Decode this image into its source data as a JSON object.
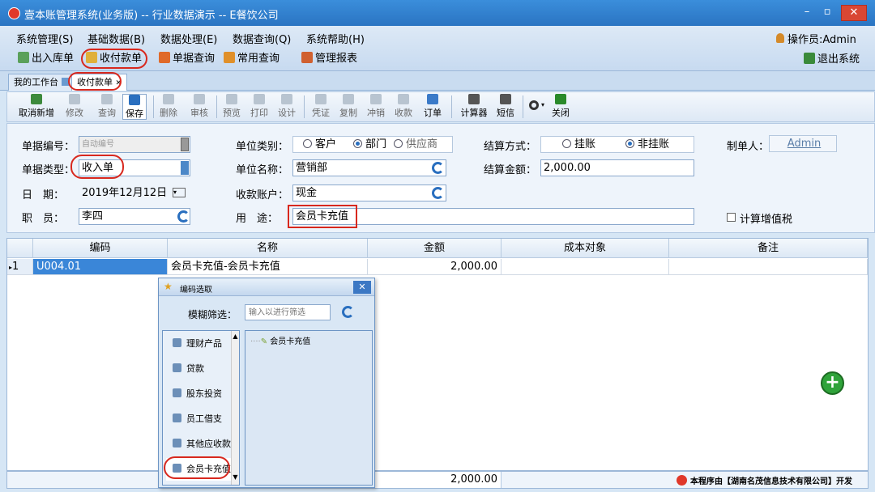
{
  "window": {
    "title": "壹本账管理系统(业务版) -- 行业数据演示 -- E餐饮公司",
    "minimize": "–",
    "maximize": "▫",
    "close": "✕"
  },
  "menu": [
    "系统管理(S)",
    "基础数据(B)",
    "数据处理(E)",
    "数据查询(Q)",
    "系统帮助(H)"
  ],
  "operator": "操作员:Admin",
  "quickbar": [
    "出入库单",
    "收付款单",
    "单据查询",
    "常用查询",
    "管理报表"
  ],
  "exit_label": "退出系统",
  "tabs": [
    "我的工作台",
    "收付款单"
  ],
  "toolbar": [
    "取消新增",
    "修改",
    "查询",
    "保存",
    "删除",
    "审核",
    "预览",
    "打印",
    "设计",
    "凭证",
    "复制",
    "冲销",
    "收款",
    "订单",
    "计算器",
    "短信",
    "关闭"
  ],
  "form": {
    "doc_no_label": "单据编号：",
    "doc_no_value": "自动编号",
    "doc_type_label": "单据类型：",
    "doc_type_value": "收入单",
    "date_label": "日　期：",
    "date_value": "2019年12月12日",
    "staff_label": "职　员：",
    "staff_value": "李四",
    "unit_type_label": "单位类别：",
    "unit_type_options": [
      "客户",
      "部门",
      "供应商"
    ],
    "unit_type_selected": "部门",
    "unit_name_label": "单位名称：",
    "unit_name_value": "营销部",
    "account_label": "收款账户：",
    "account_value": "现金",
    "purpose_label": "用　途：",
    "purpose_value": "会员卡充值",
    "settle_label": "结算方式：",
    "settle_options": [
      "挂账",
      "非挂账"
    ],
    "settle_selected": "非挂账",
    "amount_label": "结算金额：",
    "amount_value": "2,000.00",
    "maker_label": "制单人：",
    "maker_value": "Admin",
    "vat_label": "计算增值税"
  },
  "grid": {
    "headers": [
      "编码",
      "名称",
      "金额",
      "成本对象",
      "备注"
    ],
    "rows": [
      {
        "index": "1",
        "code": "U004.01",
        "name": "会员卡充值-会员卡充值",
        "amount": "2,000.00",
        "cost": "",
        "note": ""
      }
    ],
    "total": "2,000.00"
  },
  "popup": {
    "title": "编码选取",
    "filter_label": "模糊筛选：",
    "filter_placeholder": "输入以进行筛选",
    "categories": [
      "理财产品",
      "贷款",
      "股东投资",
      "员工借支",
      "其他应收款",
      "会员卡充值"
    ],
    "selected_category": "会员卡充值",
    "tree_items": [
      "会员卡充值"
    ]
  },
  "footer_credit": "本程序由【湖南名茂信息技术有限公司】开发",
  "colors": {
    "accent": "#2a74c2",
    "highlight": "#d8281e",
    "add": "#2fa33a"
  }
}
